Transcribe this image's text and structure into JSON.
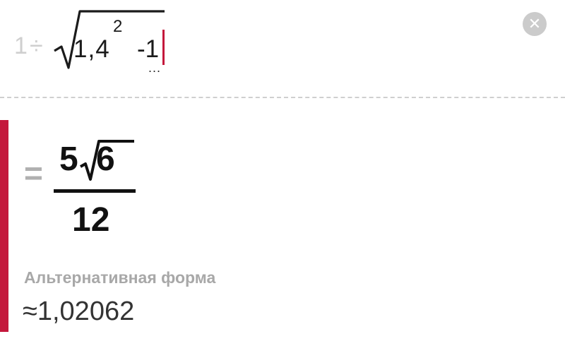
{
  "input": {
    "one": "1",
    "divide": "÷",
    "base": "1,4",
    "exponent": "2",
    "minus_one": "-1",
    "dots": "...",
    "caret_color": "#c4183c"
  },
  "clear_icon": {
    "name": "clear-icon",
    "glyph": "✕"
  },
  "result": {
    "equals": "=",
    "numerator_coef": "5",
    "numerator_radicand": "6",
    "denominator": "12",
    "alt_label": "Альтернативная форма",
    "approx": "≈1,02062"
  },
  "colors": {
    "accent": "#c4183c",
    "ghost": "#cfcfcf",
    "text": "#111111",
    "muted": "#a8a8a8"
  }
}
